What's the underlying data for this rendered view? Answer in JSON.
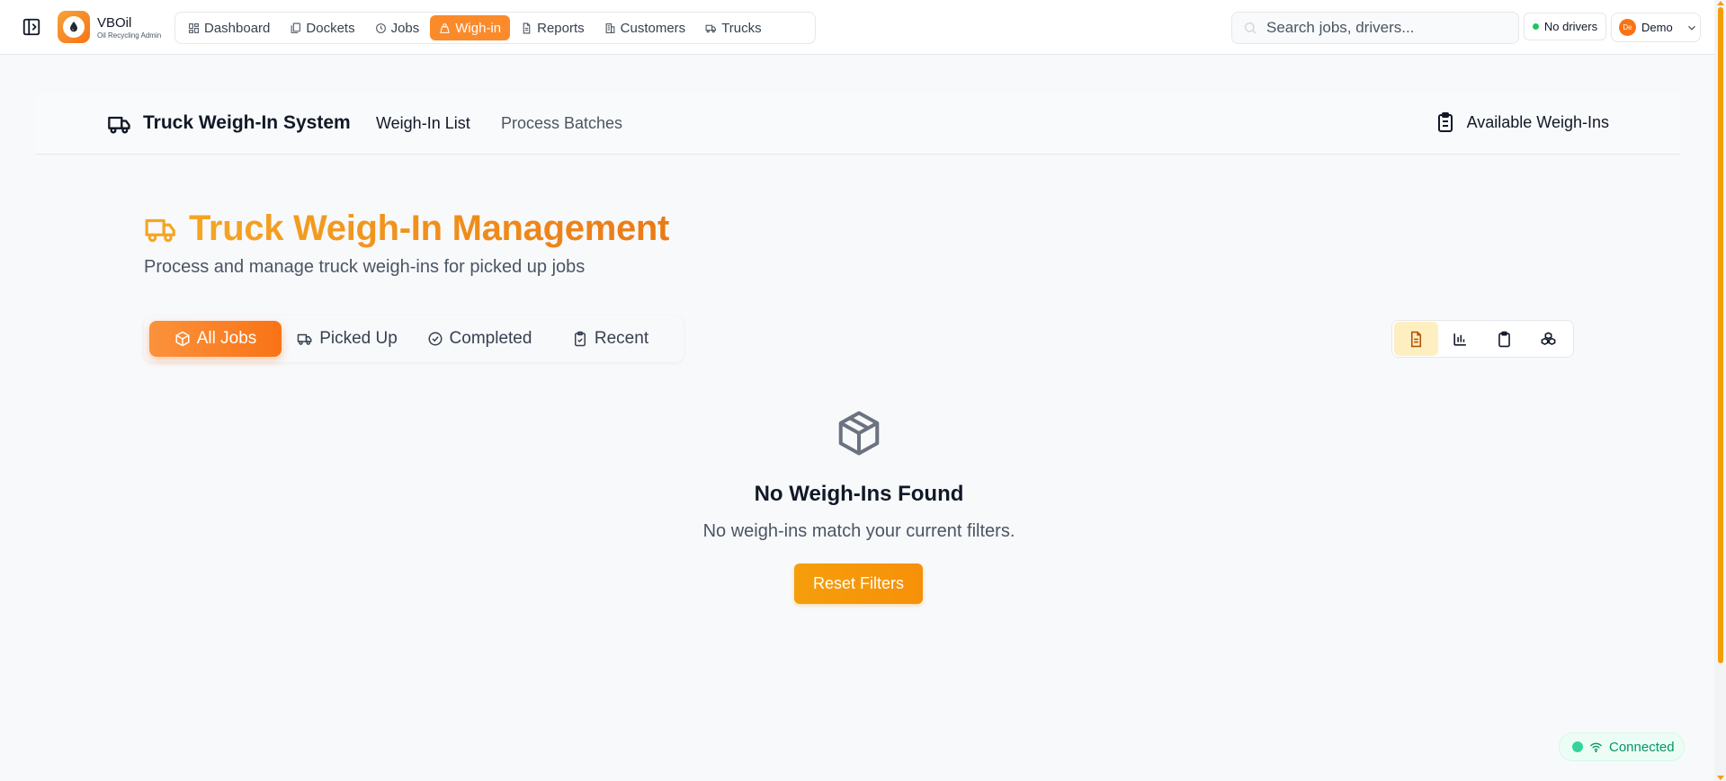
{
  "app": {
    "brand_name": "VBOil",
    "brand_sub": "Oil Recycling Admin"
  },
  "nav": {
    "items": [
      {
        "label": "Dashboard",
        "icon": "dashboard-icon"
      },
      {
        "label": "Dockets",
        "icon": "dockets-icon"
      },
      {
        "label": "Jobs",
        "icon": "clock-icon"
      },
      {
        "label": "Wigh-in",
        "icon": "weight-icon",
        "active": true
      },
      {
        "label": "Reports",
        "icon": "document-icon"
      },
      {
        "label": "Customers",
        "icon": "building-icon"
      },
      {
        "label": "Trucks",
        "icon": "truck-icon"
      }
    ]
  },
  "search": {
    "placeholder": "Search jobs, drivers..."
  },
  "drivers_status": "No drivers",
  "user": {
    "initials": "De",
    "name": "Demo"
  },
  "subheader": {
    "title": "Truck Weigh-In System",
    "tabs": [
      "Weigh-In List",
      "Process Batches"
    ],
    "available_label": "Available Weigh-Ins"
  },
  "page": {
    "title": "Truck Weigh-In Management",
    "subtitle": "Process and manage truck weigh-ins for picked up jobs"
  },
  "filters": {
    "tabs": [
      {
        "label": "All Jobs",
        "icon": "box-icon",
        "active": true
      },
      {
        "label": "Picked Up",
        "icon": "truck-icon"
      },
      {
        "label": "Completed",
        "icon": "check-circle-icon"
      },
      {
        "label": "Recent",
        "icon": "clipboard-check-icon"
      }
    ]
  },
  "views": [
    "document-view-icon",
    "bar-chart-icon",
    "clipboard-icon",
    "cluster-icon"
  ],
  "empty_state": {
    "title": "No Weigh-Ins Found",
    "description": "No weigh-ins match your current filters.",
    "button_label": "Reset Filters"
  },
  "connection": {
    "label": "Connected"
  },
  "colors": {
    "accent": "#f97316",
    "accent_amber": "#f59e0b",
    "connected": "#059669"
  }
}
